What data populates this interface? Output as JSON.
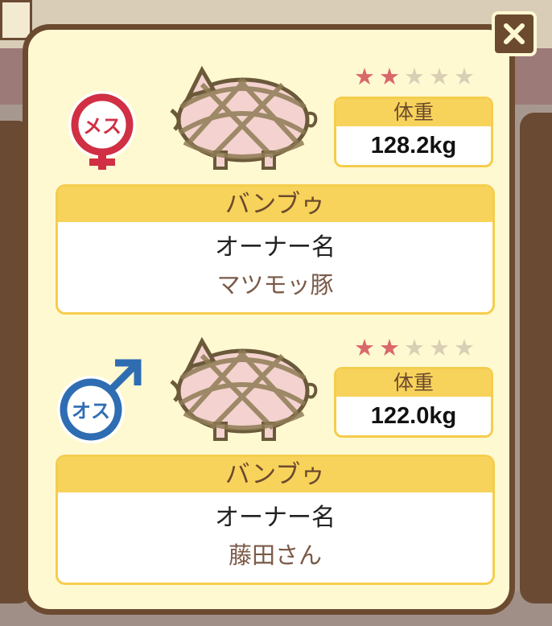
{
  "modal": {
    "close_icon": "close-icon"
  },
  "pigs": [
    {
      "gender_label": "メス",
      "gender_icon": "female-icon",
      "gender_color": "#d02f44",
      "rating": 2,
      "rating_max": 5,
      "weight_label": "体重",
      "weight_value": "128.2kg",
      "breed": "バンブゥ",
      "owner_label": "オーナー名",
      "owner_name": "マツモッ豚"
    },
    {
      "gender_label": "オス",
      "gender_icon": "male-icon",
      "gender_color": "#2f6db3",
      "rating": 2,
      "rating_max": 5,
      "weight_label": "体重",
      "weight_value": "122.0kg",
      "breed": "バンブゥ",
      "owner_label": "オーナー名",
      "owner_name": "藤田さん"
    }
  ],
  "colors": {
    "frame": "#6b4a2f",
    "panel": "#fff9d2",
    "header": "#f8d35b",
    "star_on": "#d9686a",
    "star_off": "#d9cfb4"
  }
}
